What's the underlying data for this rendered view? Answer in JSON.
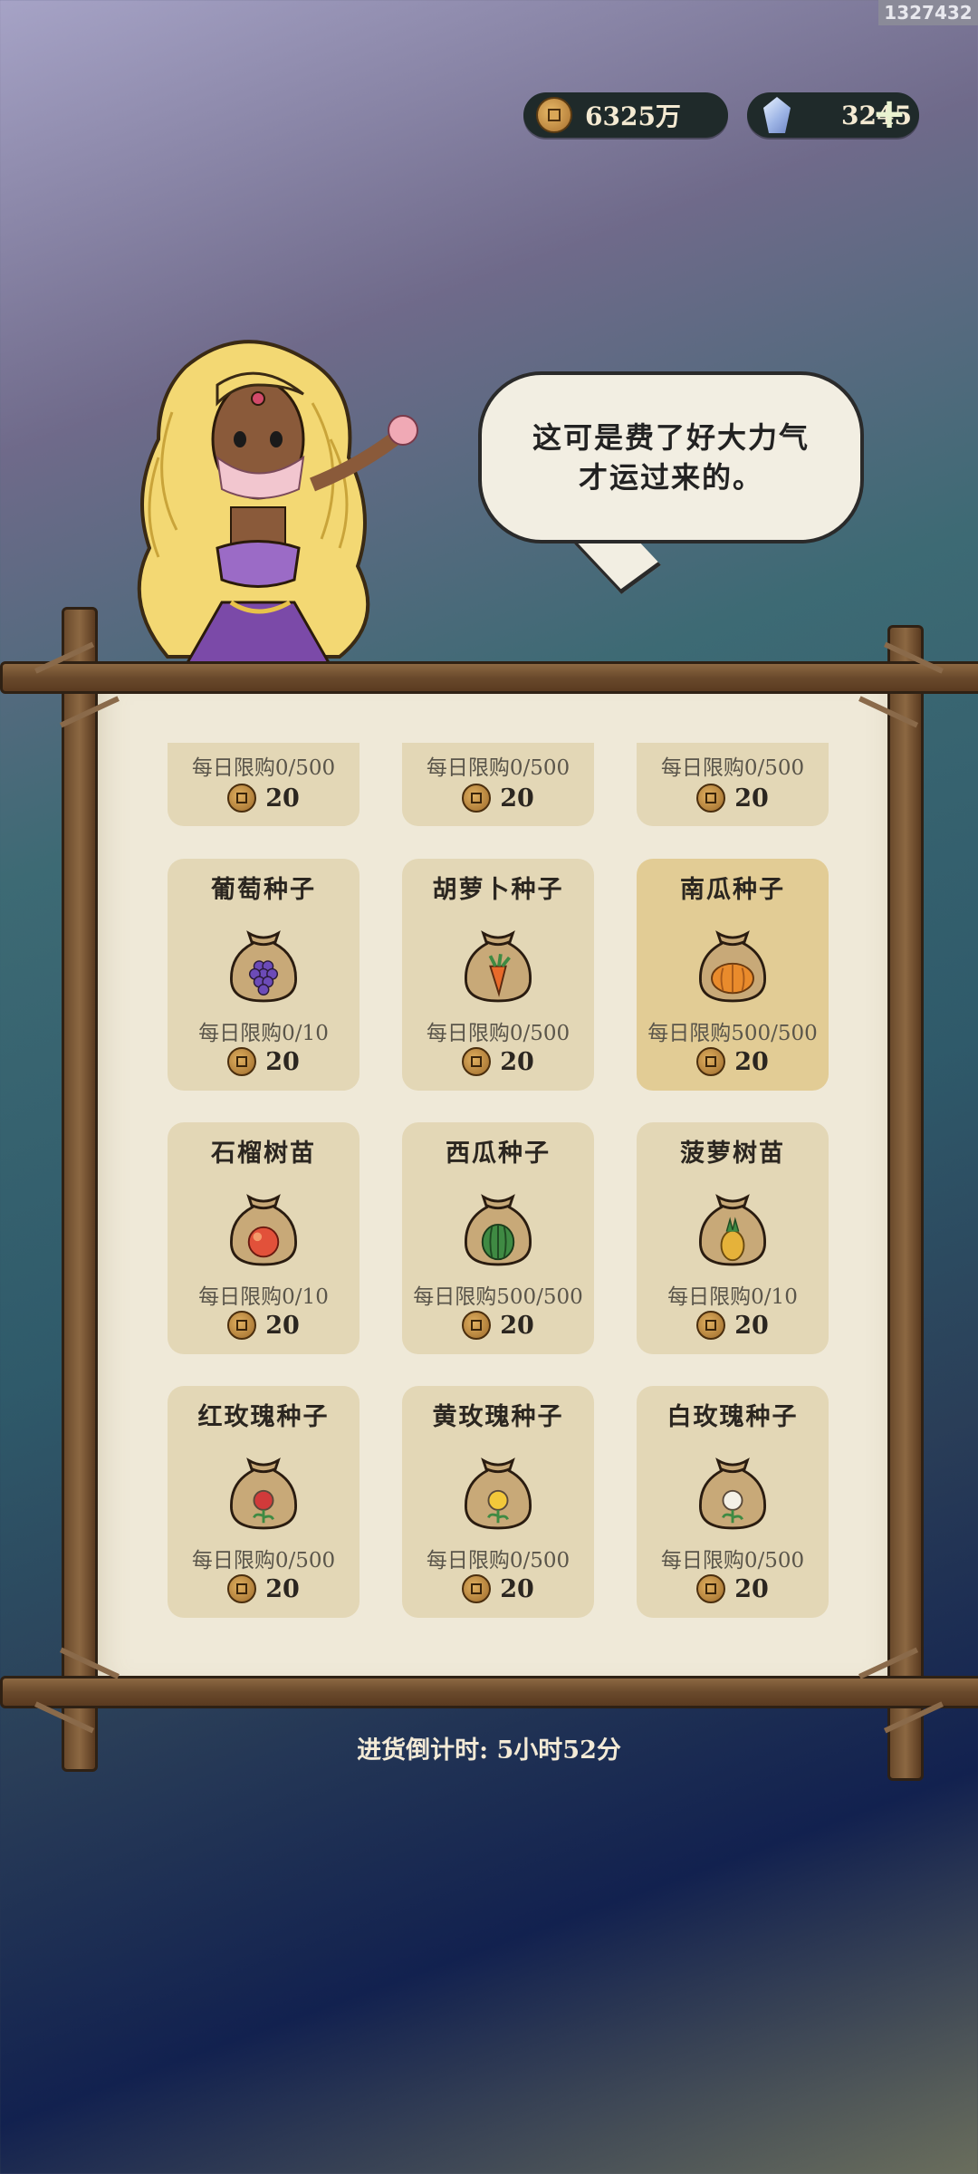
{
  "id_tag": "1327432",
  "currency": {
    "coins": "6325万",
    "gems": "3245",
    "plus": "+"
  },
  "speech": {
    "line1": "这可是费了好大力气",
    "line2": "才运过来的。"
  },
  "top_row": [
    {
      "limit": "每日限购0/500",
      "price": "20"
    },
    {
      "limit": "每日限购0/500",
      "price": "20"
    },
    {
      "limit": "每日限购0/500",
      "price": "20"
    }
  ],
  "items": [
    {
      "name": "葡萄种子",
      "limit": "每日限购0/10",
      "price": "20",
      "fruit": "grape-icon",
      "color": "#6c4bb8"
    },
    {
      "name": "胡萝卜种子",
      "limit": "每日限购0/500",
      "price": "20",
      "fruit": "carrot-icon",
      "color": "#e86a2a"
    },
    {
      "name": "南瓜种子",
      "limit": "每日限购500/500",
      "price": "20",
      "fruit": "pumpkin-icon",
      "color": "#e98b2c"
    },
    {
      "name": "石榴树苗",
      "limit": "每日限购0/10",
      "price": "20",
      "fruit": "pomegranate-icon",
      "color": "#e2513a"
    },
    {
      "name": "西瓜种子",
      "limit": "每日限购500/500",
      "price": "20",
      "fruit": "watermelon-icon",
      "color": "#3f8a43"
    },
    {
      "name": "菠萝树苗",
      "limit": "每日限购0/10",
      "price": "20",
      "fruit": "pineapple-icon",
      "color": "#e5b23a"
    },
    {
      "name": "红玫瑰种子",
      "limit": "每日限购0/500",
      "price": "20",
      "fruit": "red-rose-icon",
      "color": "#d13a3a"
    },
    {
      "name": "黄玫瑰种子",
      "limit": "每日限购0/500",
      "price": "20",
      "fruit": "yellow-rose-icon",
      "color": "#f2c83a"
    },
    {
      "name": "白玫瑰种子",
      "limit": "每日限购0/500",
      "price": "20",
      "fruit": "white-rose-icon",
      "color": "#f4f1e6"
    }
  ],
  "restock": "进货倒计时: 5小时52分"
}
